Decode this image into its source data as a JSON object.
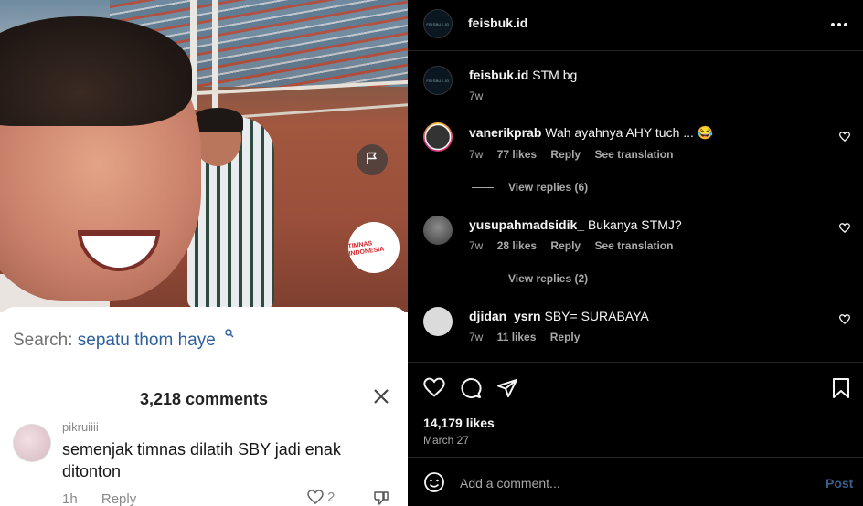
{
  "media": {
    "badge_text": "TIMNAS INDONESIA",
    "search": {
      "label": "Search:",
      "query": "sepatu thom haye"
    },
    "comments_count": "3,218 comments",
    "comment": {
      "username": "pikruiiii",
      "text": "semenjak timnas dilatih SBY jadi enak ditonton",
      "time": "1h",
      "reply_label": "Reply",
      "likes": "2"
    }
  },
  "post": {
    "username": "feisbuk.id",
    "avatar_text": "FEISBUK.ID",
    "caption": {
      "username": "feisbuk.id",
      "text": "STM bg",
      "time": "7w"
    },
    "comments": [
      {
        "username": "vanerikprab",
        "text": "Wah ayahnya AHY tuch ... 😂",
        "time": "7w",
        "likes": "77 likes",
        "reply": "Reply",
        "translate": "See translation",
        "view_replies": "View replies (6)"
      },
      {
        "username": "yusupahmadsidik_",
        "text": "Bukanya STMJ?",
        "time": "7w",
        "likes": "28 likes",
        "reply": "Reply",
        "translate": "See translation",
        "view_replies": "View replies (2)"
      },
      {
        "username": "djidan_ysrn",
        "text": "SBY= SURABAYA",
        "time": "7w",
        "likes": "11 likes",
        "reply": "Reply"
      }
    ],
    "likes": "14,179 likes",
    "date": "March 27",
    "add_comment_placeholder": "Add a comment...",
    "post_label": "Post"
  },
  "colors": {
    "accent_link": "#2c5f9e",
    "post_button": "#3a5f8c",
    "background": "#000000"
  },
  "icons": [
    "flag-icon",
    "search-icon",
    "close-icon",
    "heart-icon",
    "dislike-icon",
    "more-icon",
    "comment-icon",
    "share-icon",
    "bookmark-icon",
    "emoji-icon"
  ]
}
